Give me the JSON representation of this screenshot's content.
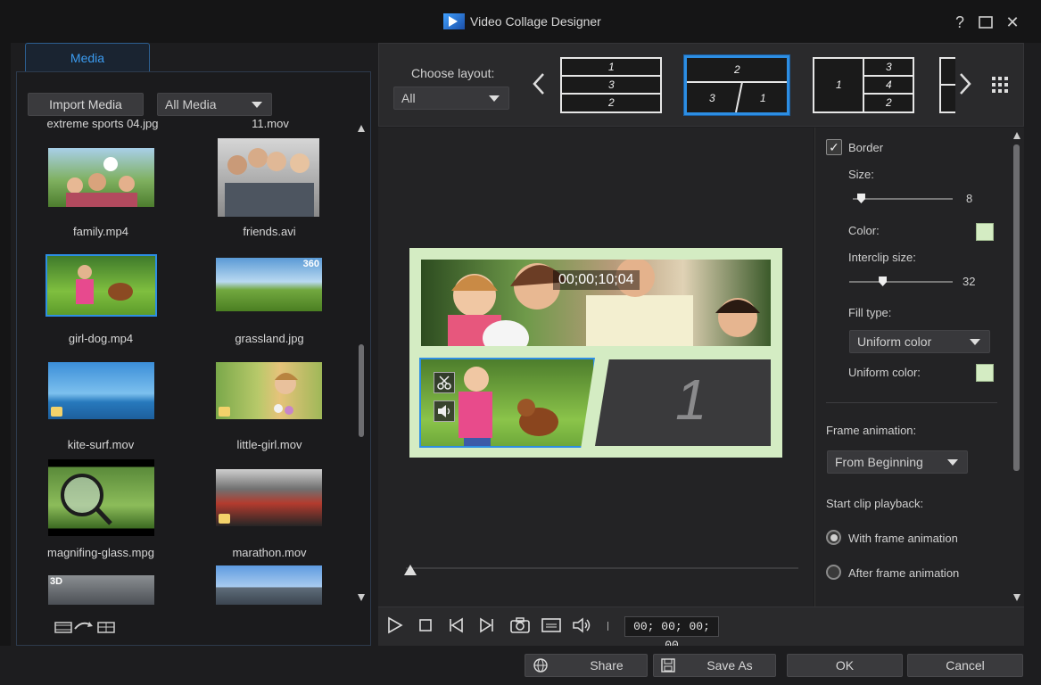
{
  "window": {
    "title": "Video Collage Designer",
    "help_glyph": "?",
    "maximize_glyph": "☐",
    "close_glyph": "✕"
  },
  "media": {
    "tab_label": "Media",
    "import_label": "Import Media",
    "filter_value": "All Media",
    "partial_top_left": "extreme sports 04.jpg",
    "partial_top_right": "11.mov",
    "items": [
      {
        "name": "family.mp4",
        "badge": ""
      },
      {
        "name": "friends.avi",
        "badge": ""
      },
      {
        "name": "girl-dog.mp4",
        "badge": ""
      },
      {
        "name": "grassland.jpg",
        "badge": "360"
      },
      {
        "name": "kite-surf.mov",
        "badge": ""
      },
      {
        "name": "little-girl.mov",
        "badge": ""
      },
      {
        "name": "magnifing-glass.mpg",
        "badge": ""
      },
      {
        "name": "marathon.mov",
        "badge": ""
      },
      {
        "name": "",
        "badge": "3D"
      },
      {
        "name": "",
        "badge": ""
      }
    ]
  },
  "layout": {
    "choose_label": "Choose layout:",
    "filter_value": "All",
    "options": [
      {
        "labels": [
          "1",
          "3",
          "2"
        ]
      },
      {
        "labels": [
          "2",
          "3",
          "1"
        ]
      },
      {
        "labels": [
          "1",
          "3",
          "4",
          "2"
        ]
      }
    ]
  },
  "preview": {
    "timecode_overlay": "00;00;10;04",
    "empty_slot_number": "1"
  },
  "properties": {
    "border_label": "Border",
    "size_label": "Size:",
    "size_value": "8",
    "color_label": "Color:",
    "interclip_label": "Interclip size:",
    "interclip_value": "32",
    "fill_type_label": "Fill type:",
    "fill_type_value": "Uniform color",
    "uniform_color_label": "Uniform color:",
    "frame_anim_label": "Frame animation:",
    "frame_anim_value": "From Beginning",
    "start_playback_label": "Start clip playback:",
    "radio_with": "With frame animation",
    "radio_after": "After frame animation",
    "border_color": "#d4ecc3",
    "size_slider_fraction": 0.08,
    "interclip_slider_fraction": 0.32
  },
  "player": {
    "timecode": "00; 00; 00; 00"
  },
  "footer": {
    "share": "Share",
    "save_as": "Save As",
    "ok": "OK",
    "cancel": "Cancel"
  }
}
